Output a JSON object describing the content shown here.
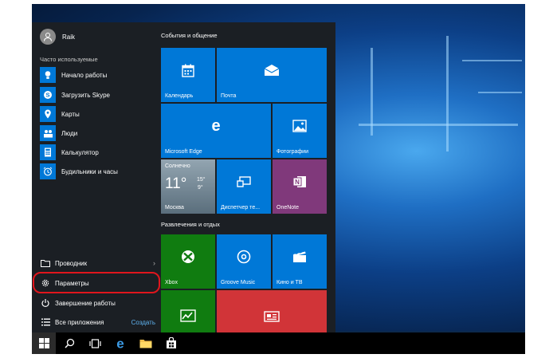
{
  "user": {
    "name": "Raik"
  },
  "most_used_header": "Часто используемые",
  "apps": [
    {
      "label": "Начало работы",
      "icon": "lightbulb-icon"
    },
    {
      "label": "Загрузить Skype",
      "icon": "skype-icon"
    },
    {
      "label": "Карты",
      "icon": "maps-icon"
    },
    {
      "label": "Люди",
      "icon": "people-icon"
    },
    {
      "label": "Калькулятор",
      "icon": "calculator-icon"
    },
    {
      "label": "Будильники и часы",
      "icon": "alarm-icon"
    }
  ],
  "system": {
    "explorer": "Проводник",
    "settings": "Параметры",
    "shutdown": "Завершение работы",
    "all_apps": "Все приложения",
    "create": "Создать"
  },
  "groups": {
    "life": "События и общение",
    "play": "Развлечения и отдых"
  },
  "tiles": {
    "calendar": "Календарь",
    "mail": "Почта",
    "edge": "Microsoft Edge",
    "photos": "Фотографии",
    "weather_title": "Солнечно",
    "weather_temp": "11°",
    "weather_hi": "15°",
    "weather_lo": "9°",
    "weather_city": "Москва",
    "taskmgr": "Диспетчер те...",
    "onenote": "OneNote",
    "xbox": "Xbox",
    "groove": "Groove Music",
    "movies": "Кино и ТВ"
  },
  "colors": {
    "accent": "#0078d7",
    "xbox": "#107c10",
    "onenote": "#80397b",
    "news": "#d13438",
    "money": "#107c10",
    "highlight": "#e0161d"
  }
}
